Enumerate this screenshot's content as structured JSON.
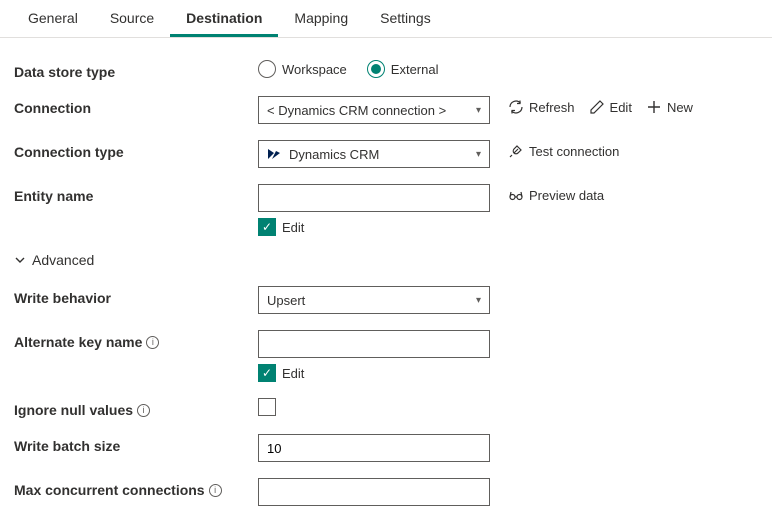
{
  "tabs": {
    "general": "General",
    "source": "Source",
    "destination": "Destination",
    "mapping": "Mapping",
    "settings": "Settings"
  },
  "labels": {
    "dataStoreType": "Data store type",
    "connection": "Connection",
    "connectionType": "Connection type",
    "entityName": "Entity name",
    "advanced": "Advanced",
    "writeBehavior": "Write behavior",
    "alternateKeyName": "Alternate key name",
    "ignoreNullValues": "Ignore null values",
    "writeBatchSize": "Write batch size",
    "maxConcurrentConnections": "Max concurrent connections"
  },
  "radios": {
    "workspace": "Workspace",
    "external": "External"
  },
  "values": {
    "connectionPlaceholder": "< Dynamics CRM connection >",
    "connectionType": "Dynamics CRM",
    "entityName": "",
    "writeBehavior": "Upsert",
    "alternateKeyName": "",
    "writeBatchSize": "10",
    "maxConcurrentConnections": ""
  },
  "actions": {
    "refresh": "Refresh",
    "edit": "Edit",
    "new": "New",
    "testConnection": "Test connection",
    "previewData": "Preview data",
    "editCheckbox": "Edit"
  }
}
